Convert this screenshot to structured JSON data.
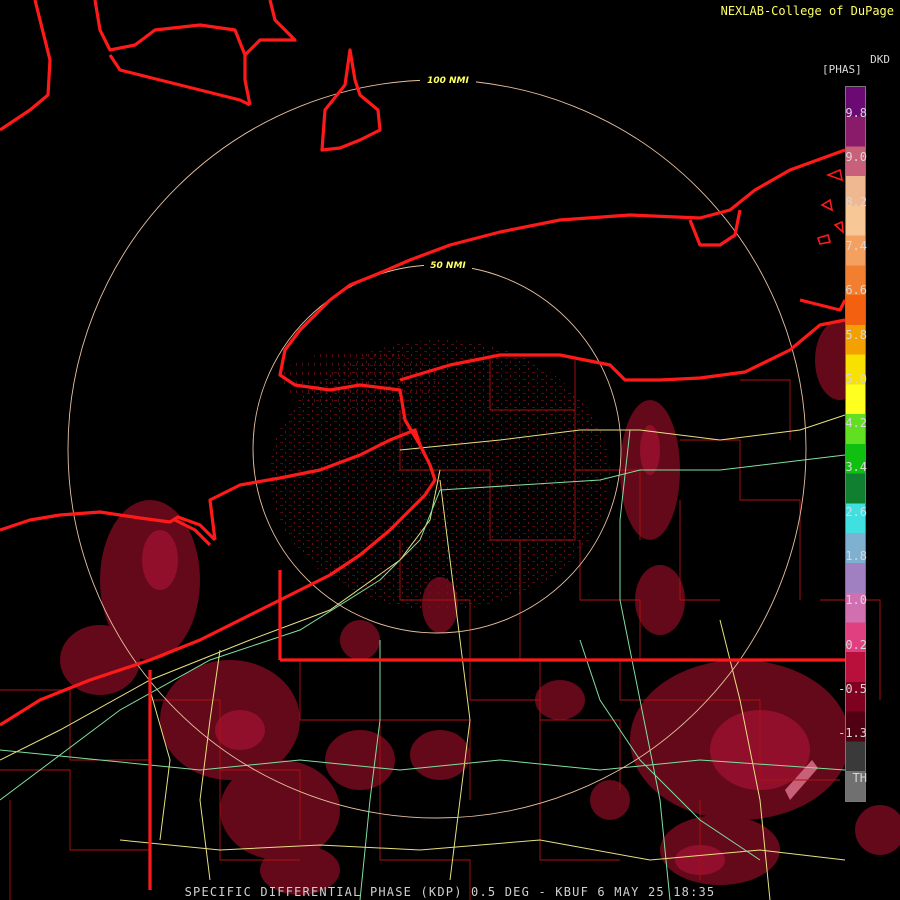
{
  "credit": "NEXLAB-College of DuPage",
  "legend": {
    "product": "DKD",
    "units": "[PHAS]",
    "ticks": [
      "9.8",
      "9.0",
      "8.2",
      "7.4",
      "6.6",
      "5.8",
      "5.0",
      "4.2",
      "3.4",
      "2.6",
      "1.8",
      "1.0",
      "0.2",
      "-0.5",
      "-1.3",
      "TH"
    ],
    "colors": [
      "#6a0a72",
      "#8a1a6a",
      "#c8607a",
      "#f0b890",
      "#f7c896",
      "#f3a060",
      "#f27f30",
      "#f26010",
      "#f4a000",
      "#f8e000",
      "#ffff20",
      "#60e020",
      "#10c010",
      "#108030",
      "#40e0e0",
      "#80b0d0",
      "#a080c0",
      "#d070b0",
      "#e04080",
      "#b8103a",
      "#800020",
      "#500010",
      "#3a3a3a",
      "#707070"
    ]
  },
  "range_rings": [
    {
      "label": "50 NMI",
      "radius_nmi": 50
    },
    {
      "label": "100 NMI",
      "radius_nmi": 100
    }
  ],
  "caption": "SPECIFIC DIFFERENTIAL PHASE (KDP) 0.5 DEG - KBUF 6 MAY 25 18:35"
}
